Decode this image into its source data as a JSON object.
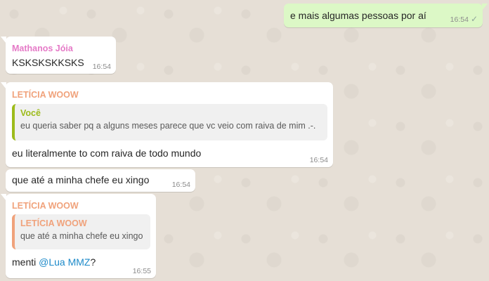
{
  "colors": {
    "outgoing_bubble": "#dcf8c6",
    "incoming_bubble": "#ffffff",
    "sender_mathanos": "#e57ac7",
    "sender_leticia": "#f0a27b",
    "quote_voce": "#9dbb1a",
    "mention": "#1d8ac9"
  },
  "messages": [
    {
      "direction": "outgoing",
      "text": "e mais algumas pessoas por aí",
      "time": "16:54",
      "status_icon": "check-icon",
      "status_glyph": "✓"
    },
    {
      "direction": "incoming",
      "sender": "Mathanos Jóia",
      "text": "KSKSKSKKSKS",
      "time": "16:54"
    },
    {
      "direction": "incoming",
      "sender": "LETÍCIA WOOW",
      "quote": {
        "author": "Você",
        "text": "eu queria saber pq a alguns meses parece que vc veio com raiva de mim .-."
      },
      "text": "eu literalmente to com raiva de todo mundo",
      "time": "16:54"
    },
    {
      "direction": "incoming",
      "text": "que até a minha chefe eu xingo",
      "time": "16:54"
    },
    {
      "direction": "incoming",
      "sender": "LETÍCIA WOOW",
      "quote": {
        "author": "LETÍCIA WOOW",
        "text": "que até a minha chefe eu xingo"
      },
      "text_prefix": "menti ",
      "mention": "@Lua MMZ",
      "text_suffix": "?",
      "time": "16:55"
    }
  ]
}
